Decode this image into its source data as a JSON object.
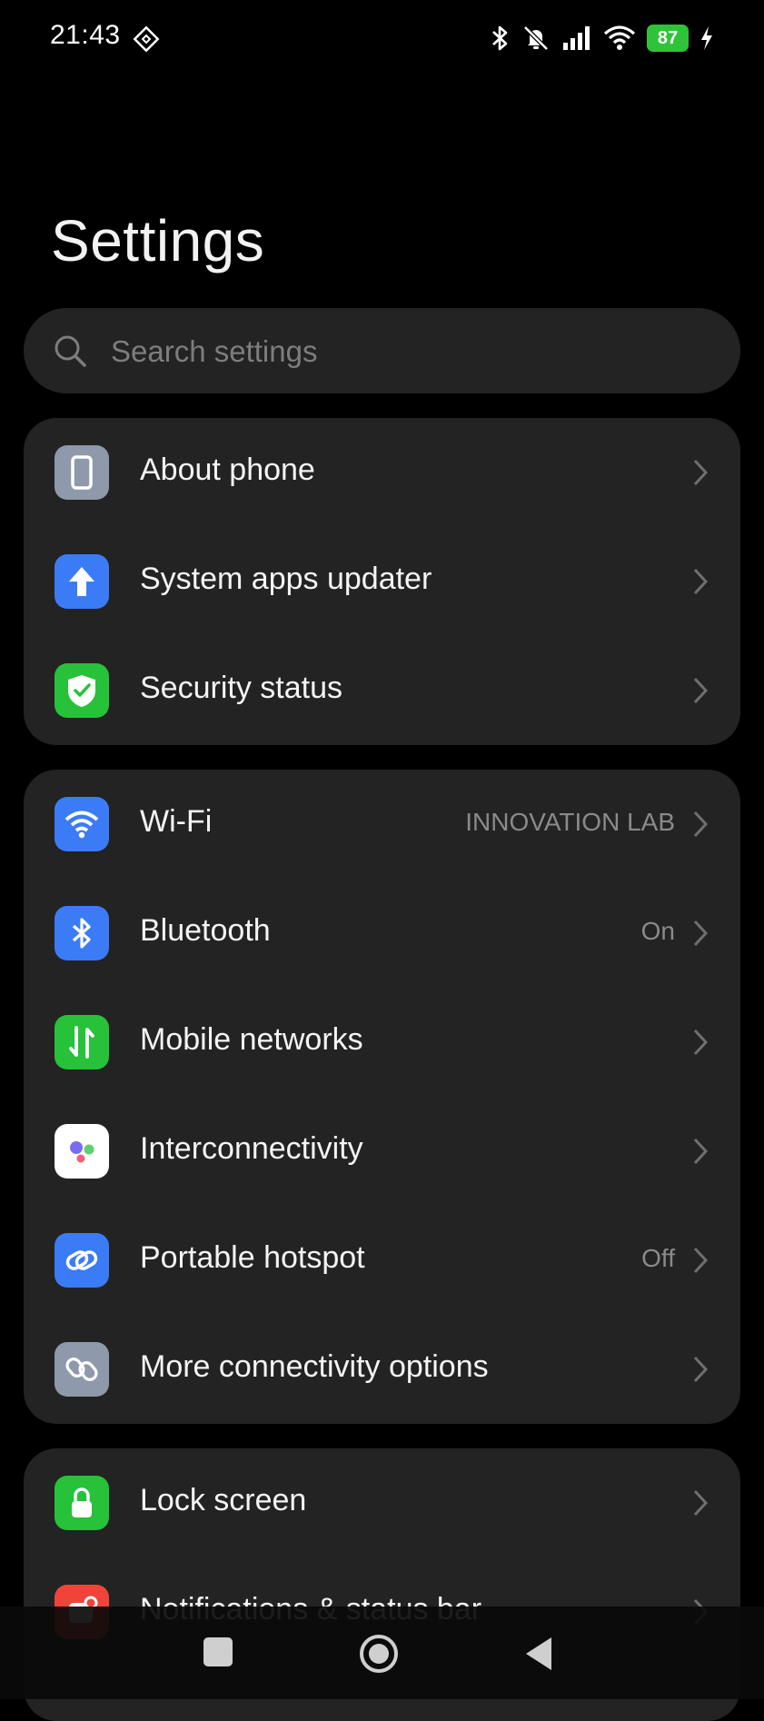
{
  "status_bar": {
    "time": "21:43",
    "battery": "87",
    "icons": [
      "nfc-icon",
      "bluetooth-icon",
      "mute-icon",
      "signal-icon",
      "wifi-icon",
      "battery-icon",
      "charging-icon"
    ]
  },
  "page": {
    "title": "Settings"
  },
  "search": {
    "placeholder": "Search settings"
  },
  "groups": [
    {
      "items": [
        {
          "label": "About phone",
          "icon": "phone-icon",
          "color": "#8e9aab"
        },
        {
          "label": "System apps updater",
          "icon": "upload-arrow-icon",
          "color": "#3b7cf6"
        },
        {
          "label": "Security status",
          "icon": "shield-icon",
          "color": "#27c13a"
        }
      ]
    },
    {
      "items": [
        {
          "label": "Wi-Fi",
          "value": "INNOVATION LAB",
          "icon": "wifi-icon",
          "color": "#3b7cf6"
        },
        {
          "label": "Bluetooth",
          "value": "On",
          "icon": "bluetooth-icon",
          "color": "#3b7cf6"
        },
        {
          "label": "Mobile networks",
          "icon": "mobile-data-icon",
          "color": "#27c13a"
        },
        {
          "label": "Interconnectivity",
          "icon": "interconnectivity-icon",
          "color": "#ffffff"
        },
        {
          "label": "Portable hotspot",
          "value": "Off",
          "icon": "link-icon",
          "color": "#3b7cf6"
        },
        {
          "label": "More connectivity options",
          "icon": "connectivity-icon",
          "color": "#8e9aab"
        }
      ]
    },
    {
      "items": [
        {
          "label": "Lock screen",
          "icon": "lock-icon",
          "color": "#27c13a"
        },
        {
          "label": "Notifications & status bar",
          "icon": "notifications-icon",
          "color": "#f0443a"
        }
      ]
    }
  ],
  "nav_bar": {
    "icons": [
      "recents-icon",
      "home-icon",
      "back-icon"
    ]
  }
}
